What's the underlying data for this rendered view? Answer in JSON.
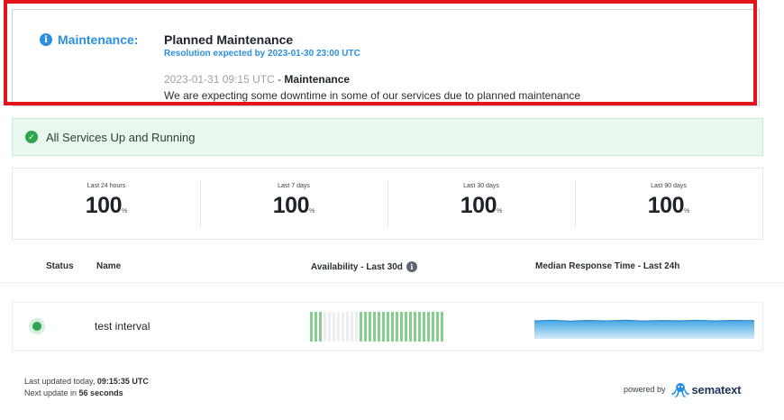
{
  "maintenance": {
    "label": "Maintenance:",
    "title": "Planned Maintenance",
    "resolution": "Resolution expected by 2023-01-30 23:00 UTC",
    "update_time": "2023-01-31 09:15 UTC",
    "update_separator": " - ",
    "update_title": "Maintenance",
    "message": "We are expecting some downtime in some of our services due to planned maintenance"
  },
  "status_banner": {
    "text": "All Services Up and Running"
  },
  "stats": [
    {
      "period": "Last 24 hours",
      "value": "100",
      "unit": "%"
    },
    {
      "period": "Last 7 days",
      "value": "100",
      "unit": "%"
    },
    {
      "period": "Last 30 days",
      "value": "100",
      "unit": "%"
    },
    {
      "period": "Last 90 days",
      "value": "100",
      "unit": "%"
    }
  ],
  "table": {
    "headers": {
      "status": "Status",
      "name": "Name",
      "availability": "Availability - Last 30d",
      "median": "Median Response Time - Last 24h"
    },
    "rows": [
      {
        "name": "test interval",
        "availability_days": [
          "up",
          "up",
          "up",
          "none",
          "none",
          "none",
          "none",
          "none",
          "none",
          "none",
          "none",
          "up",
          "up",
          "up",
          "up",
          "up",
          "up",
          "up",
          "up",
          "up",
          "up",
          "up",
          "up",
          "up",
          "up",
          "up",
          "up",
          "up",
          "up",
          "up"
        ]
      }
    ]
  },
  "colors": {
    "up": "#86cf8f",
    "none": "#eeeeee",
    "accent": "#2b8fe0",
    "success": "#2ea44f"
  },
  "footer": {
    "updated_label": "Last updated today, ",
    "updated_time": "09:15:35 UTC",
    "next_label": "Next update in ",
    "next_value": "56 seconds",
    "powered_by": "powered by",
    "brand": "sematext"
  }
}
